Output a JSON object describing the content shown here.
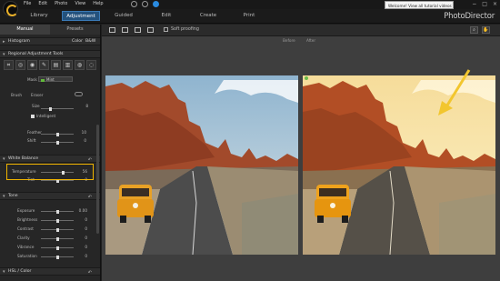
{
  "menu": {
    "items": [
      "File",
      "Edit",
      "Photo",
      "View",
      "Help"
    ]
  },
  "tooltip": "Welcome! View all tutorial videos here!",
  "window_controls": [
    "−",
    "□",
    "×"
  ],
  "nav": {
    "tabs": [
      "Library",
      "Adjustment",
      "Guided",
      "Edit",
      "Create",
      "Print"
    ],
    "active": "Adjustment"
  },
  "brand": "PhotoDirector",
  "panel": {
    "tabs": [
      "Manual",
      "Presets"
    ],
    "histogram": {
      "title": "Histogram",
      "color_label": "Color",
      "bw_label": "B&W"
    },
    "regional": {
      "title": "Regional Adjustment Tools",
      "tools": [
        "crop-icon",
        "red-eye-icon",
        "eye-icon",
        "brush-icon",
        "gradient-icon",
        "filter-icon",
        "stamp-icon",
        "radial-icon"
      ],
      "mask_label": "Mask",
      "mask_value": "Mint",
      "brush_label": "Brush",
      "eraser_label": "Eraser",
      "size_label": "Size",
      "size_value": "8",
      "intelligent_label": "Intelligent",
      "feather_label": "Feather",
      "feather_value": "10",
      "shift_label": "Shift",
      "shift_value": "0"
    },
    "white_balance": {
      "title": "White Balance",
      "temperature_label": "Temperature",
      "temperature_value": "56",
      "tint_label": "Tint",
      "tint_value": "0"
    },
    "tone": {
      "title": "Tone",
      "rows": [
        {
          "label": "Exposure",
          "value": "0.00"
        },
        {
          "label": "Brightness",
          "value": "0"
        },
        {
          "label": "Contrast",
          "value": "0"
        },
        {
          "label": "Clarity",
          "value": "0"
        },
        {
          "label": "Vibrance",
          "value": "0"
        },
        {
          "label": "Saturation",
          "value": "0"
        }
      ]
    },
    "hsl_title": "HSL / Color"
  },
  "workspace": {
    "soft_proofing_label": "Soft proofing",
    "before_label": "Before",
    "after_label": "After"
  },
  "colors": {
    "accent_blue": "#24527d",
    "highlight": "#f0b400",
    "arrow": "#f2c62e"
  }
}
